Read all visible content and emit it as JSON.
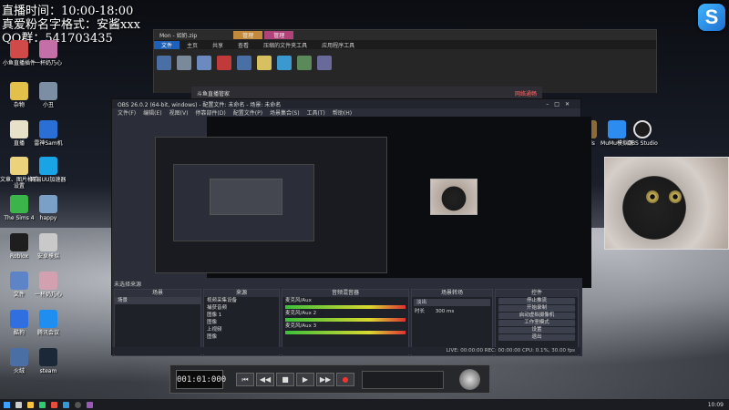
{
  "overlay": {
    "line1": "直播时间：10:00-18:00",
    "line2": "真爱粉名字格式：安酱xxx",
    "line3": "QQ群：541703435"
  },
  "desktop_icons": [
    {
      "label": "小鱼直播插件",
      "color": "#d04a4a"
    },
    {
      "label": "一杯奶乃心",
      "color": "#c46fa8"
    },
    {
      "label": "杂物",
      "color": "#e2c04a"
    },
    {
      "label": "小丑",
      "color": "#7b8ea3"
    },
    {
      "label": "直播",
      "color": "#e8e0c8"
    },
    {
      "label": "雷神Sam机",
      "color": "#2a6fd6"
    },
    {
      "label": "文章、图片格式 设置",
      "color": "#ecd27a"
    },
    {
      "label": "网易UU加速器",
      "color": "#19a4e6"
    },
    {
      "label": "The Sims 4",
      "color": "#3bb54a"
    },
    {
      "label": "happy",
      "color": "#7aa0c8"
    },
    {
      "label": "Roblox",
      "color": "#1e1e1e"
    },
    {
      "label": "安卓模拟",
      "color": "#c9c9c9"
    },
    {
      "label": "文件",
      "color": "#5e84c8"
    },
    {
      "label": "一杯奶乃心",
      "color": "#d3a0b0"
    },
    {
      "label": "酷狗",
      "color": "#2f6fe0"
    },
    {
      "label": "腾讯会议",
      "color": "#1e8ef0"
    },
    {
      "label": "火绒",
      "color": "#4a6fa5"
    },
    {
      "label": "steam",
      "color": "#1b2838"
    }
  ],
  "right_icons": [
    {
      "label": "Mods",
      "color": "#8b6a3a"
    },
    {
      "label": "MuMu模拟器",
      "color": "#2d8cf0"
    },
    {
      "label": "OBS Studio",
      "color": "#1c1c1c"
    }
  ],
  "explorer": {
    "title": "Mon - 如奶.zip",
    "tabs": [
      "文件",
      "主页",
      "共享",
      "查看",
      "压缩的文件夹工具",
      "管理",
      "应用程序工具"
    ]
  },
  "douyu": {
    "title": "斗鱼直播管家",
    "status": "网络通畅"
  },
  "obs": {
    "title": "OBS 26.0.2 (64-bit, windows) - 配置文件: 未命名 - 场景: 未命名",
    "menu": [
      "文件(F)",
      "编辑(E)",
      "视图(V)",
      "停靠部件(D)",
      "配置文件(P)",
      "场景集合(S)",
      "工具(T)",
      "帮助(H)"
    ],
    "scene_label": "未选择来源",
    "docks": {
      "scenes": {
        "title": "场景",
        "items": [
          "场景"
        ]
      },
      "sources": {
        "title": "来源",
        "items": [
          "视频采集设备",
          "捕获音频",
          "图像 1",
          "图像",
          "上视频",
          "图像"
        ]
      },
      "mixer": {
        "title": "音频混音器",
        "tracks": [
          "麦克风/Aux",
          "麦克风/Aux 2",
          "麦克风/Aux 3"
        ],
        "level": "0.0 dB"
      },
      "transitions": {
        "title": "场景转场",
        "type": "淡出",
        "duration_label": "时长",
        "duration": "300 ms"
      },
      "controls": {
        "title": "控件",
        "buttons": [
          "停止推流",
          "开始录制",
          "启动虚拟摄像机",
          "工作室模式",
          "设置",
          "退出"
        ]
      }
    },
    "statusbar": "LIVE: 00:00:00   REC: 00:00:00   CPU: 0.1%, 30.00 fps"
  },
  "player": {
    "timecode": "001:01:000",
    "buttons": [
      "⏮",
      "◀◀",
      "■",
      "▶",
      "▶▶",
      "●"
    ]
  },
  "taskbar": {
    "clock": "10:09"
  }
}
